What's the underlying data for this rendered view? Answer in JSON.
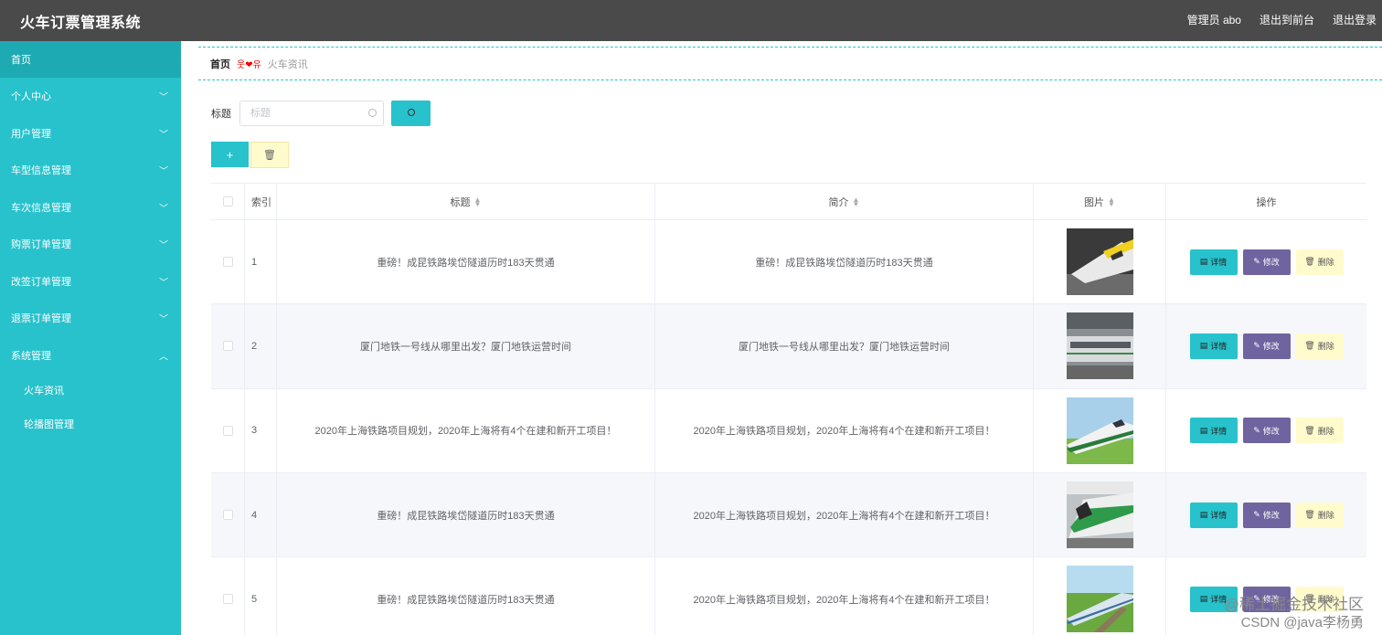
{
  "topbar": {
    "title": "火车订票管理系统",
    "admin": "管理员 abo",
    "to_front": "退出到前台",
    "logout": "退出登录"
  },
  "sidebar": {
    "home": "首页",
    "menus": [
      {
        "label": "个人中心",
        "icon": "chevron-down-icon"
      },
      {
        "label": "用户管理",
        "icon": "chevron-down-icon"
      },
      {
        "label": "车型信息管理",
        "icon": "chevron-down-icon"
      },
      {
        "label": "车次信息管理",
        "icon": "chevron-down-icon"
      },
      {
        "label": "购票订单管理",
        "icon": "chevron-down-icon"
      },
      {
        "label": "改签订单管理",
        "icon": "chevron-down-icon"
      },
      {
        "label": "退票订单管理",
        "icon": "chevron-down-icon"
      },
      {
        "label": "系统管理",
        "icon": "chevron-up-icon"
      }
    ],
    "sub_items": [
      "火车资讯",
      "轮播图管理"
    ]
  },
  "breadcrumb": {
    "home": "首页",
    "separator": "웃❤유",
    "current": "火车资讯"
  },
  "search": {
    "label": "标题",
    "placeholder": "标题"
  },
  "actions": {
    "add": "+",
    "delete": "🗑"
  },
  "table": {
    "headers": {
      "index": "索引",
      "title": "标题",
      "intro": "简介",
      "picture": "图片",
      "operation": "操作"
    },
    "rows": [
      {
        "index": "1",
        "title": "重磅！成昆铁路埃岱隧道历时183天贯通",
        "intro": "重磅！成昆铁路埃岱隧道历时183天贯通"
      },
      {
        "index": "2",
        "title": "厦门地铁一号线从哪里出发？厦门地铁运营时间",
        "intro": "厦门地铁一号线从哪里出发？厦门地铁运营时间"
      },
      {
        "index": "3",
        "title": "2020年上海铁路项目规划，2020年上海将有4个在建和新开工项目！",
        "intro": "2020年上海铁路项目规划，2020年上海将有4个在建和新开工项目！"
      },
      {
        "index": "4",
        "title": "重磅！成昆铁路埃岱隧道历时183天贯通",
        "intro": "2020年上海铁路项目规划，2020年上海将有4个在建和新开工项目！"
      },
      {
        "index": "5",
        "title": "重磅！成昆铁路埃岱隧道历时183天贯通",
        "intro": "2020年上海铁路项目规划，2020年上海将有4个在建和新开工项目！"
      }
    ],
    "op_labels": {
      "detail": "详情",
      "edit": "修改",
      "delete": "删除"
    }
  },
  "watermark": {
    "line1": "@稀土掘金技术社区",
    "line2": "CSDN @java李杨勇"
  },
  "colors": {
    "primary": "#27c2cc",
    "topbar": "#4a4a4a",
    "edit": "#6f64a0",
    "delete": "#fffbcc"
  }
}
